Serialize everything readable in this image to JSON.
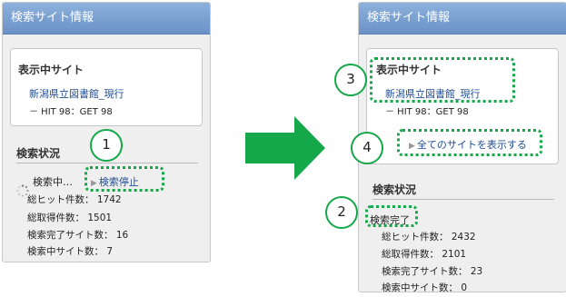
{
  "left_panel": {
    "header_title": "検索サイト情報",
    "card": {
      "title": "表示中サイト",
      "site_link": "新潟県立図書館_現行",
      "site_stats": "－ HIT 98：GET 98"
    },
    "status_section": {
      "title": "検索状況",
      "searching_label": "検索中…",
      "stop_button": "検索停止",
      "stats": [
        "総ヒット件数： 1742",
        "総取得件数： 1501",
        "検索完了サイト数： 16",
        "検索中サイト数： 7"
      ]
    }
  },
  "right_panel": {
    "header_title": "検索サイト情報",
    "card": {
      "title": "表示中サイト",
      "site_link": "新潟県立図書館_現行",
      "site_stats": "－ HIT 98：GET 98",
      "show_all_button": "全てのサイトを表示する"
    },
    "status_section": {
      "title": "検索状況",
      "complete_label": "検索完了",
      "stats": [
        "総ヒット件数： 2432",
        "総取得件数： 2101",
        "検索完了サイト数： 23",
        "検索中サイト数： 0"
      ]
    }
  },
  "callouts": [
    "1",
    "2",
    "3",
    "4"
  ],
  "colors": {
    "accent_green": "#15a84a",
    "header_blue": "#7aa0d2",
    "link_blue": "#1f4e96"
  },
  "icons": {
    "transition": "right-arrow-icon",
    "loading": "spinner-icon",
    "bullet": "triangle-right-icon"
  }
}
